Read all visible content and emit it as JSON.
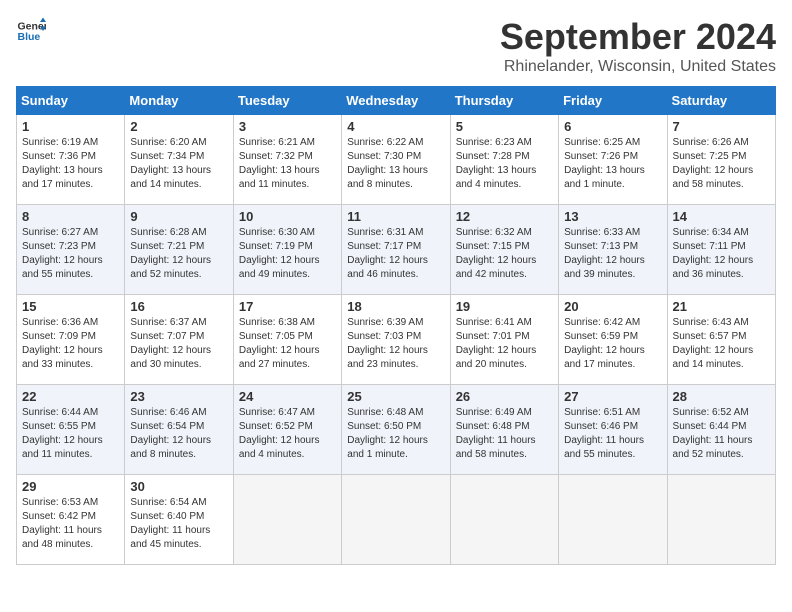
{
  "header": {
    "logo_line1": "General",
    "logo_line2": "Blue",
    "month": "September 2024",
    "location": "Rhinelander, Wisconsin, United States"
  },
  "weekdays": [
    "Sunday",
    "Monday",
    "Tuesday",
    "Wednesday",
    "Thursday",
    "Friday",
    "Saturday"
  ],
  "weeks": [
    [
      {
        "day": "1",
        "info": "Sunrise: 6:19 AM\nSunset: 7:36 PM\nDaylight: 13 hours\nand 17 minutes."
      },
      {
        "day": "2",
        "info": "Sunrise: 6:20 AM\nSunset: 7:34 PM\nDaylight: 13 hours\nand 14 minutes."
      },
      {
        "day": "3",
        "info": "Sunrise: 6:21 AM\nSunset: 7:32 PM\nDaylight: 13 hours\nand 11 minutes."
      },
      {
        "day": "4",
        "info": "Sunrise: 6:22 AM\nSunset: 7:30 PM\nDaylight: 13 hours\nand 8 minutes."
      },
      {
        "day": "5",
        "info": "Sunrise: 6:23 AM\nSunset: 7:28 PM\nDaylight: 13 hours\nand 4 minutes."
      },
      {
        "day": "6",
        "info": "Sunrise: 6:25 AM\nSunset: 7:26 PM\nDaylight: 13 hours\nand 1 minute."
      },
      {
        "day": "7",
        "info": "Sunrise: 6:26 AM\nSunset: 7:25 PM\nDaylight: 12 hours\nand 58 minutes."
      }
    ],
    [
      {
        "day": "8",
        "info": "Sunrise: 6:27 AM\nSunset: 7:23 PM\nDaylight: 12 hours\nand 55 minutes."
      },
      {
        "day": "9",
        "info": "Sunrise: 6:28 AM\nSunset: 7:21 PM\nDaylight: 12 hours\nand 52 minutes."
      },
      {
        "day": "10",
        "info": "Sunrise: 6:30 AM\nSunset: 7:19 PM\nDaylight: 12 hours\nand 49 minutes."
      },
      {
        "day": "11",
        "info": "Sunrise: 6:31 AM\nSunset: 7:17 PM\nDaylight: 12 hours\nand 46 minutes."
      },
      {
        "day": "12",
        "info": "Sunrise: 6:32 AM\nSunset: 7:15 PM\nDaylight: 12 hours\nand 42 minutes."
      },
      {
        "day": "13",
        "info": "Sunrise: 6:33 AM\nSunset: 7:13 PM\nDaylight: 12 hours\nand 39 minutes."
      },
      {
        "day": "14",
        "info": "Sunrise: 6:34 AM\nSunset: 7:11 PM\nDaylight: 12 hours\nand 36 minutes."
      }
    ],
    [
      {
        "day": "15",
        "info": "Sunrise: 6:36 AM\nSunset: 7:09 PM\nDaylight: 12 hours\nand 33 minutes."
      },
      {
        "day": "16",
        "info": "Sunrise: 6:37 AM\nSunset: 7:07 PM\nDaylight: 12 hours\nand 30 minutes."
      },
      {
        "day": "17",
        "info": "Sunrise: 6:38 AM\nSunset: 7:05 PM\nDaylight: 12 hours\nand 27 minutes."
      },
      {
        "day": "18",
        "info": "Sunrise: 6:39 AM\nSunset: 7:03 PM\nDaylight: 12 hours\nand 23 minutes."
      },
      {
        "day": "19",
        "info": "Sunrise: 6:41 AM\nSunset: 7:01 PM\nDaylight: 12 hours\nand 20 minutes."
      },
      {
        "day": "20",
        "info": "Sunrise: 6:42 AM\nSunset: 6:59 PM\nDaylight: 12 hours\nand 17 minutes."
      },
      {
        "day": "21",
        "info": "Sunrise: 6:43 AM\nSunset: 6:57 PM\nDaylight: 12 hours\nand 14 minutes."
      }
    ],
    [
      {
        "day": "22",
        "info": "Sunrise: 6:44 AM\nSunset: 6:55 PM\nDaylight: 12 hours\nand 11 minutes."
      },
      {
        "day": "23",
        "info": "Sunrise: 6:46 AM\nSunset: 6:54 PM\nDaylight: 12 hours\nand 8 minutes."
      },
      {
        "day": "24",
        "info": "Sunrise: 6:47 AM\nSunset: 6:52 PM\nDaylight: 12 hours\nand 4 minutes."
      },
      {
        "day": "25",
        "info": "Sunrise: 6:48 AM\nSunset: 6:50 PM\nDaylight: 12 hours\nand 1 minute."
      },
      {
        "day": "26",
        "info": "Sunrise: 6:49 AM\nSunset: 6:48 PM\nDaylight: 11 hours\nand 58 minutes."
      },
      {
        "day": "27",
        "info": "Sunrise: 6:51 AM\nSunset: 6:46 PM\nDaylight: 11 hours\nand 55 minutes."
      },
      {
        "day": "28",
        "info": "Sunrise: 6:52 AM\nSunset: 6:44 PM\nDaylight: 11 hours\nand 52 minutes."
      }
    ],
    [
      {
        "day": "29",
        "info": "Sunrise: 6:53 AM\nSunset: 6:42 PM\nDaylight: 11 hours\nand 48 minutes."
      },
      {
        "day": "30",
        "info": "Sunrise: 6:54 AM\nSunset: 6:40 PM\nDaylight: 11 hours\nand 45 minutes."
      },
      {
        "day": "",
        "info": ""
      },
      {
        "day": "",
        "info": ""
      },
      {
        "day": "",
        "info": ""
      },
      {
        "day": "",
        "info": ""
      },
      {
        "day": "",
        "info": ""
      }
    ]
  ]
}
